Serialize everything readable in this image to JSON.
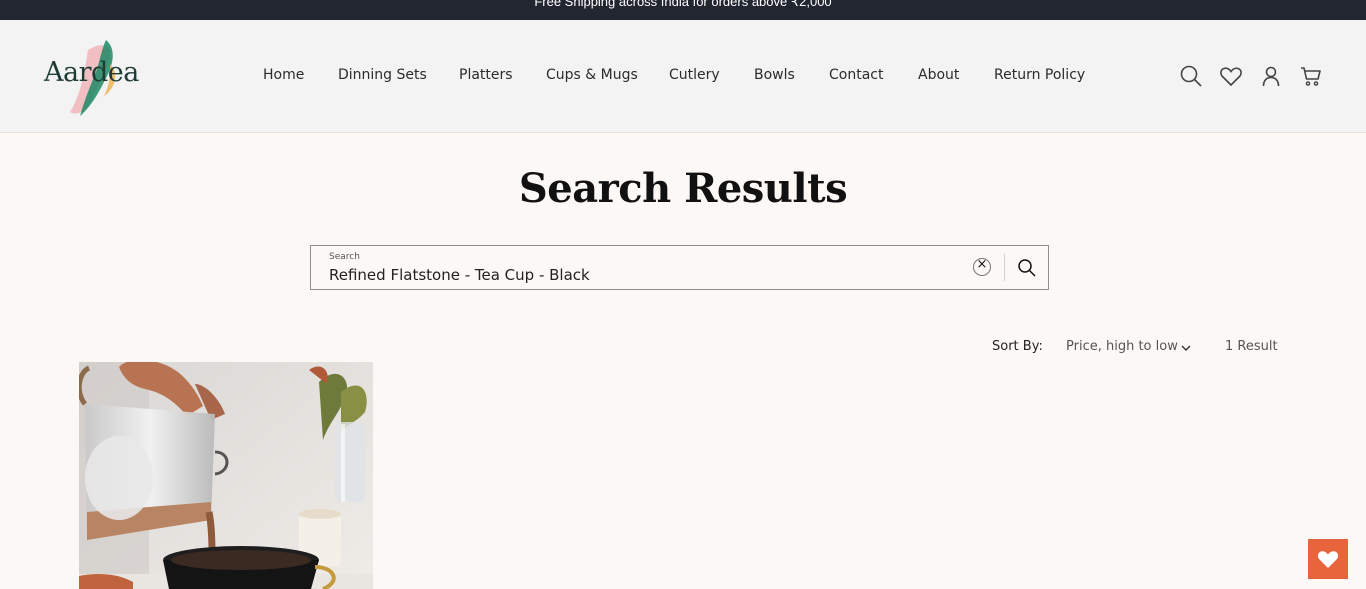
{
  "announcement": {
    "text": "Free Shipping across India for orders above ₹2,000"
  },
  "header": {
    "logo_text": "Aardea",
    "nav": [
      "Home",
      "Dinning Sets",
      "Platters",
      "Cups & Mugs",
      "Cutlery",
      "Bowls",
      "Contact",
      "About",
      "Return Policy"
    ],
    "icons": [
      "search-icon",
      "heart-icon",
      "account-icon",
      "cart-icon"
    ]
  },
  "page": {
    "title": "Search Results"
  },
  "search": {
    "label": "Search",
    "value": "Refined Flatstone - Tea Cup - Black",
    "clear_symbol": "×"
  },
  "results": {
    "sort_label": "Sort By:",
    "sort_value": "Price, high to low",
    "count_text": "1 Result"
  },
  "colors": {
    "announcement_bg": "#222630",
    "header_bg": "#f3f3f3",
    "page_bg": "#fcf8f6",
    "accent": "#e8643b"
  }
}
